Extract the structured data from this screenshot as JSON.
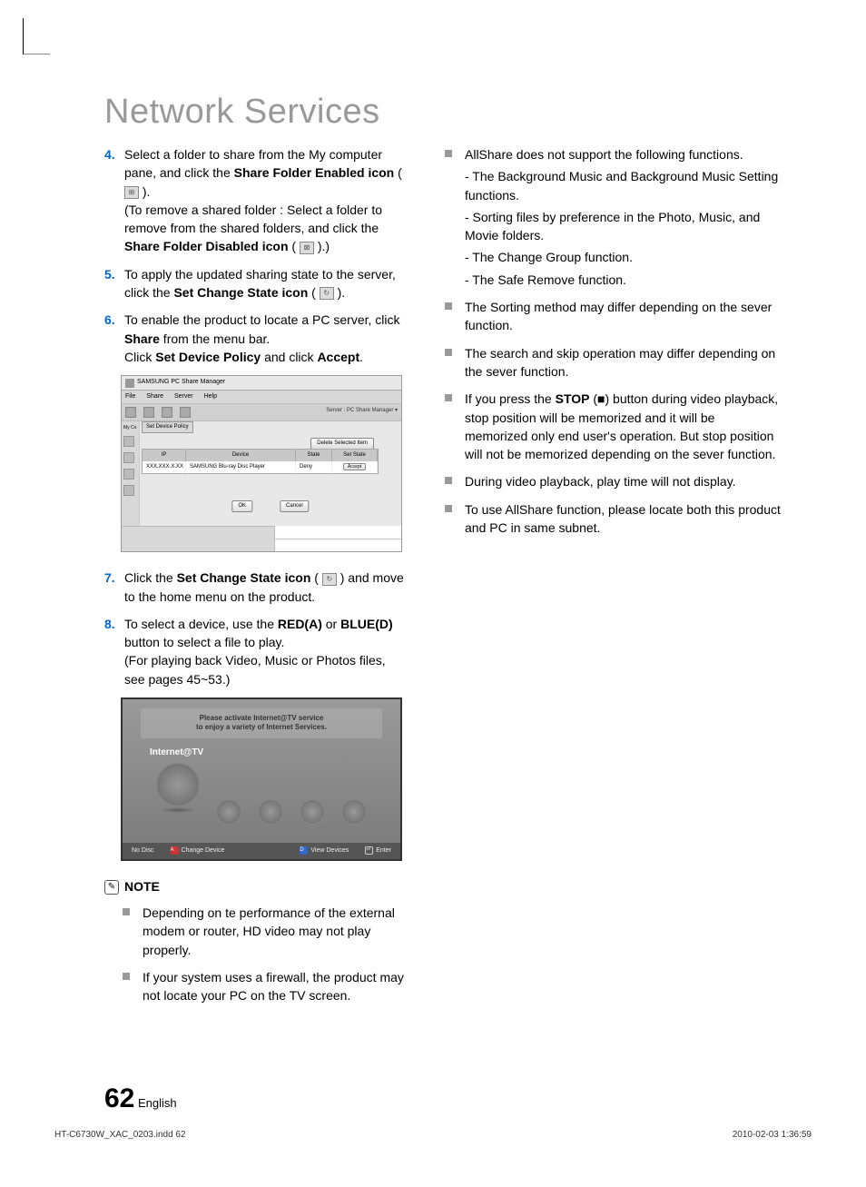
{
  "title": "Network Services",
  "steps": {
    "4": {
      "part1": "Select a folder to share from the My computer pane, and click the ",
      "bold1": "Share Folder Enabled icon",
      "part2": " ( ",
      "part3": " ).",
      "part4": "(To remove a shared folder : Select a folder to remove from the shared folders, and click the ",
      "bold2": "Share Folder Disabled icon",
      "part5": " ( ",
      "part6": " ).)"
    },
    "5": {
      "part1": "To apply the updated sharing state to the server, click the ",
      "bold1": "Set Change State icon",
      "part2": " ( ",
      "part3": " )."
    },
    "6": {
      "part1": "To enable the product to locate a PC server, click ",
      "bold1": "Share",
      "part2": " from the menu bar.",
      "part3": "Click ",
      "bold2": "Set Device Policy",
      "part4": " and click ",
      "bold3": "Accept",
      "part5": "."
    },
    "7": {
      "part1": "Click the ",
      "bold1": "Set Change State icon",
      "part2": " ( ",
      "part3": " ) and move to the home menu on the product."
    },
    "8": {
      "part1": "To select a device, use the ",
      "bold1": "RED(A)",
      "part2": " or ",
      "bold2": "BLUE(D)",
      "part3": " button to select a file to play.",
      "part4": "(For playing back Video, Music or Photos files, see pages 45~53.)"
    }
  },
  "pc_share_manager": {
    "window_title": "SAMSUNG PC Share Manager",
    "menu": [
      "File",
      "Share",
      "Server",
      "Help"
    ],
    "server_label": "Server : PC Share Manager  ▾",
    "dropdown": "Set Device Policy",
    "sidebar_label": "My Co",
    "delete_btn": "Delete Selected Item",
    "table": {
      "headers": [
        "IP",
        "Device",
        "State",
        "Set State"
      ],
      "row": {
        "ip": "XXX.XXX.X.XX",
        "device": "SAMSUNG Blu-ray Disc Player",
        "state": "Deny",
        "accept_label": "Accept"
      }
    },
    "ok": "OK",
    "cancel": "Cancel"
  },
  "internet_tv": {
    "banner_line1": "Please activate Internet@TV service",
    "banner_line2": "to enjoy a variety of Internet Services.",
    "label": "Internet@TV",
    "bottom": {
      "no_disc": "No Disc",
      "change_device": "Change Device",
      "view_devices": "View Devices",
      "enter": "Enter"
    }
  },
  "note_label": "NOTE",
  "notes_left": [
    "Depending on te performance of the external modem or router, HD video may not play properly.",
    "If your system uses a firewall, the product may not locate your PC on the TV screen."
  ],
  "right_first": {
    "intro": "AllShare does not support the following functions.",
    "subs": [
      "- The Background Music and Background Music Setting functions.",
      "- Sorting files by preference in the Photo, Music, and Movie folders.",
      "- The Change Group function.",
      "- The Safe Remove function."
    ]
  },
  "right_bullets": [
    "The Sorting method may differ depending on the sever function.",
    "The search and skip operation may differ depending on the sever function."
  ],
  "right_stop": {
    "part1": "If you press the ",
    "bold": "STOP",
    "part2": " (■) button during video playback, stop position will be memorized and it will be memorized only end user's operation. But stop position will not be memorized depending on the sever function."
  },
  "right_bullets2": [
    "During video playback, play time will not display.",
    "To use AllShare function, please locate both this product and PC in same subnet."
  ],
  "footer": {
    "page_num": "62",
    "lang": "English",
    "file_info": "HT-C6730W_XAC_0203.indd   62",
    "timestamp": "2010-02-03   1:36:59"
  }
}
